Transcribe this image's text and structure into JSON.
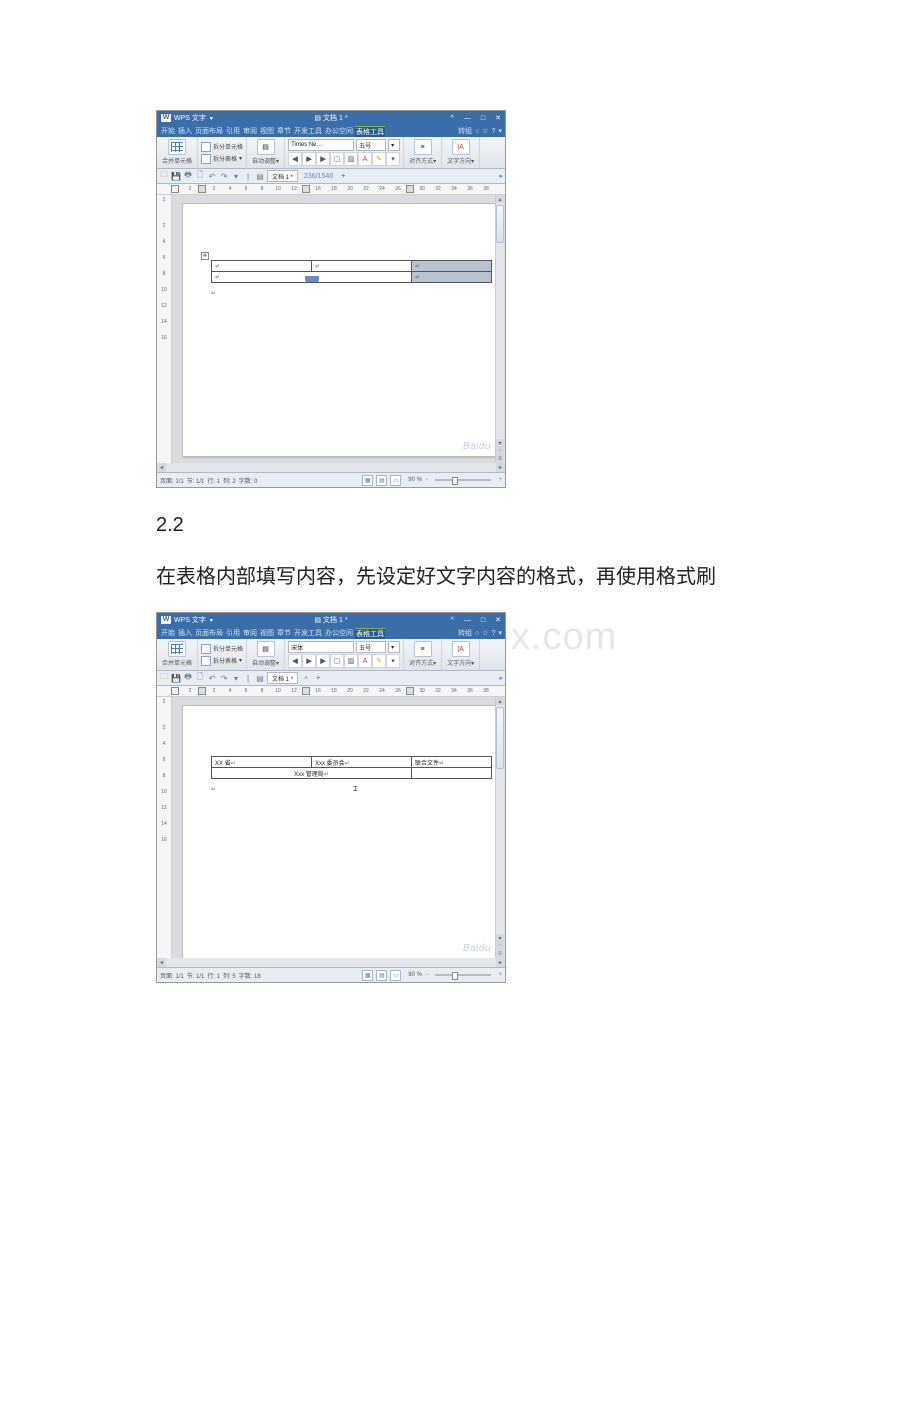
{
  "section_number": "2.2",
  "section_text": "在表格内部填写内容，先设定好文字内容的格式，再使用格式刷",
  "big_watermark": "www.bddoc.x.com",
  "shot1": {
    "app_name": "WPS 文字",
    "doc_title": "文档 1 *",
    "win_min": "^",
    "win_line": "—",
    "win_sq": "□",
    "win_x": "✕",
    "menus": [
      "开始",
      "插入",
      "页面布局",
      "引用",
      "审阅",
      "视图",
      "章节",
      "开发工具",
      "办公空间",
      "表格工具"
    ],
    "menu_tail": {
      "a": "转组",
      "b": "○",
      "c": "☆",
      "d": "?"
    },
    "ribbon": {
      "merge_btn": "合并单元格",
      "split_cell": "拆分单元格",
      "split_table": "拆分表格",
      "autofit": "自动调整",
      "font_name": "Times Ne…",
      "font_size": "五号",
      "align_label": "对齐方式",
      "textdir_label": "文字方向"
    },
    "tabbar": {
      "tab_name": "文档 1 *",
      "max_count": "236/1540",
      "plus": "+"
    },
    "ruler_nums": [
      "2",
      "",
      "2",
      "4",
      "6",
      "8",
      "10",
      "12",
      "14",
      "16",
      "18",
      "20",
      "22",
      "24",
      "26",
      "28",
      "30",
      "32",
      "34",
      "36",
      "38"
    ],
    "vruler_nums": [
      "2",
      "",
      "2",
      "4",
      "6",
      "8",
      "10",
      "12",
      "14",
      "16"
    ],
    "status": {
      "page": "页面: 1/1",
      "sect": "节: 1/1",
      "line": "行: 1",
      "col": "列: 2",
      "chars": "字数: 0",
      "zoom": "90 %"
    },
    "watermark": "Baidu"
  },
  "shot2": {
    "app_name": "WPS 文字",
    "doc_title": "文档 1 *",
    "menus": [
      "开始",
      "插入",
      "页面布局",
      "引用",
      "审阅",
      "视图",
      "章节",
      "开发工具",
      "办公空间",
      "表格工具"
    ],
    "menu_tail": {
      "a": "转组",
      "b": "○",
      "c": "☆",
      "d": "?"
    },
    "ribbon": {
      "merge_btn": "合并单元格",
      "split_cell": "拆分单元格",
      "split_table": "拆分表格",
      "autofit": "自动调整",
      "font_name": "宋体",
      "font_size": "五号",
      "align_label": "对齐方式",
      "textdir_label": "文字方向"
    },
    "tabbar": {
      "tab_name": "文档 1 *",
      "x": "×",
      "plus": "+"
    },
    "ruler_nums": [
      "2",
      "",
      "2",
      "4",
      "6",
      "8",
      "10",
      "12",
      "14",
      "16",
      "18",
      "20",
      "22",
      "24",
      "26",
      "28",
      "30",
      "32",
      "34",
      "36",
      "38"
    ],
    "vruler_nums": [
      "2",
      "",
      "2",
      "4",
      "6",
      "8",
      "10",
      "12",
      "14",
      "16"
    ],
    "table": {
      "r1c1": "XX 省",
      "r1c2": "Xxx 委员会",
      "r1c3": "联合文件",
      "r2c2": "Xxx 管理局"
    },
    "status": {
      "page": "页面: 1/1",
      "sect": "节: 1/1",
      "line": "行: 1",
      "col": "列: 5",
      "chars": "字数: 18",
      "zoom": "90 %"
    },
    "watermark": "Baidu"
  }
}
